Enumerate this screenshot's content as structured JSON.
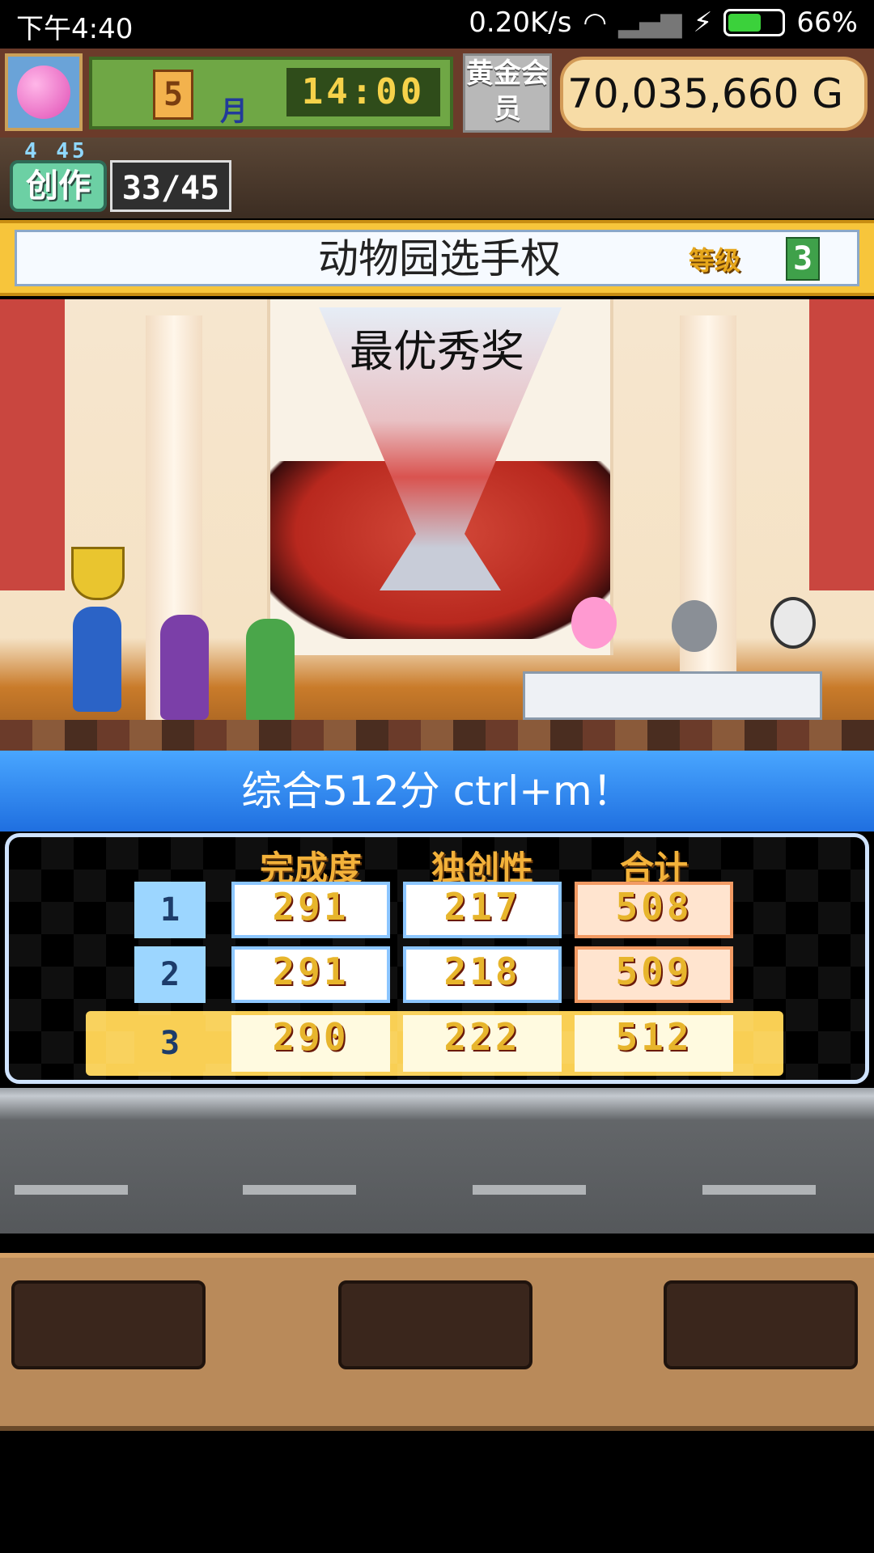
{
  "status_bar": {
    "time": "下午4:40",
    "network_speed": "0.20K/s",
    "battery_percent": "66%",
    "battery_level": 0.66
  },
  "hud": {
    "month_number": "5",
    "month_label": "月",
    "clock": "14:00",
    "gold_member": "黄金会员",
    "money": "70,035,660 G"
  },
  "creation": {
    "label": "创作",
    "small_stats": "4 45",
    "count": "33/45"
  },
  "banner": {
    "title": "动物园选手权",
    "level_label": "等级",
    "level": "3"
  },
  "stage": {
    "award_text": "最优秀奖"
  },
  "result": {
    "header": "综合512分 ctrl+m！",
    "columns": [
      "完成度",
      "独创性",
      "合计"
    ],
    "rows": [
      {
        "rank": "1",
        "completion": "291",
        "originality": "217",
        "total": "508"
      },
      {
        "rank": "2",
        "completion": "291",
        "originality": "218",
        "total": "509"
      },
      {
        "rank": "3",
        "completion": "290",
        "originality": "222",
        "total": "512"
      }
    ]
  },
  "colors": {
    "result_header": "#2f86f0",
    "banner_gold": "#f7c53b",
    "highlight_row": "#f9cf54"
  }
}
